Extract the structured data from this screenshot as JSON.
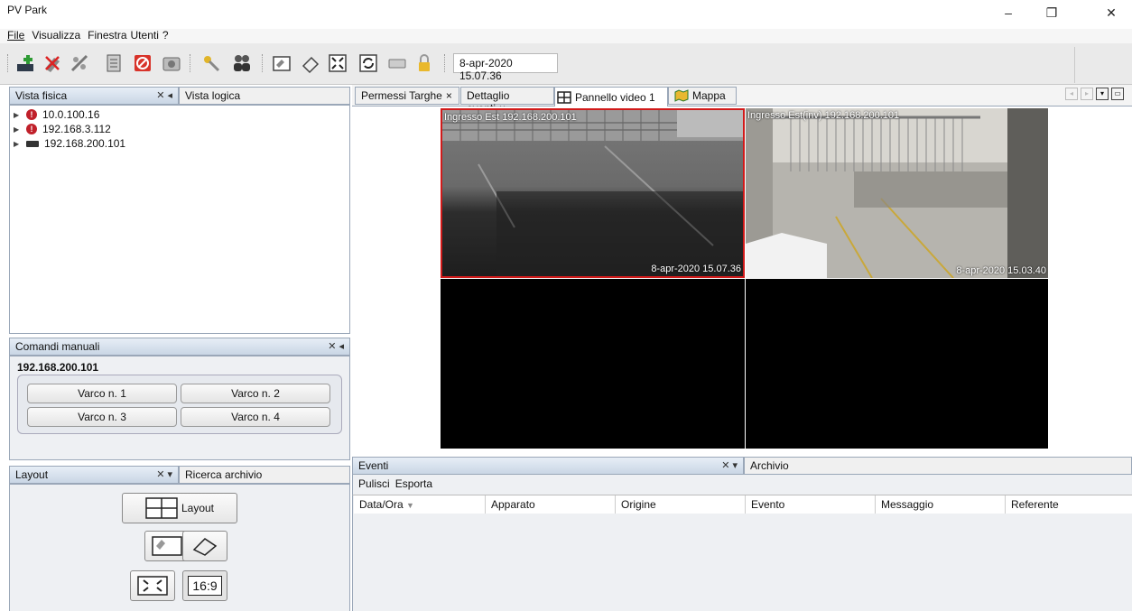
{
  "window": {
    "title": "PV Park",
    "controls": [
      "–",
      "❐",
      "✕"
    ]
  },
  "menu": {
    "items": [
      {
        "label": "File"
      },
      {
        "label": "Visualizza"
      },
      {
        "label": "Finestra"
      },
      {
        "label": "Utenti"
      },
      {
        "label": "?"
      }
    ]
  },
  "toolbar": {
    "datetime": "8-apr-2020 15.07.36"
  },
  "left_top": {
    "tabs": [
      {
        "label": "Vista fisica"
      },
      {
        "label": "Vista logica"
      }
    ],
    "devices": [
      {
        "ip": "10.0.100.16",
        "status": "error"
      },
      {
        "ip": "192.168.3.112",
        "status": "error"
      },
      {
        "ip": "192.168.200.101",
        "status": "camera"
      }
    ]
  },
  "manual": {
    "title": "Comandi manuali",
    "device": "192.168.200.101",
    "buttons": [
      "Varco n. 1",
      "Varco n. 2",
      "Varco n. 3",
      "Varco n. 4"
    ]
  },
  "layout_panel": {
    "tabs": [
      {
        "label": "Layout"
      },
      {
        "label": "Ricerca archivio"
      }
    ],
    "layout_button": "Layout",
    "ratio_button": "16:9"
  },
  "main_tabs": [
    {
      "label": "Permessi Targhe"
    },
    {
      "label": "Dettaglio eventi"
    },
    {
      "label": "Pannello video 1"
    },
    {
      "label": "Mappa"
    }
  ],
  "videos": [
    {
      "name": "Ingresso Est 192.168.200.101",
      "time": "8-apr-2020 15.07.36",
      "selected": true
    },
    {
      "name": "Ingresso Est(inv) 192.168.200.101",
      "time": "8-apr-2020 15.03.40",
      "selected": false
    }
  ],
  "events": {
    "tabs": [
      {
        "label": "Eventi"
      },
      {
        "label": "Archivio"
      }
    ],
    "actions": [
      "Pulisci",
      "Esporta"
    ],
    "columns": [
      "Data/Ora",
      "Apparato",
      "Origine",
      "Evento",
      "Messaggio",
      "Referente"
    ],
    "rows": []
  }
}
